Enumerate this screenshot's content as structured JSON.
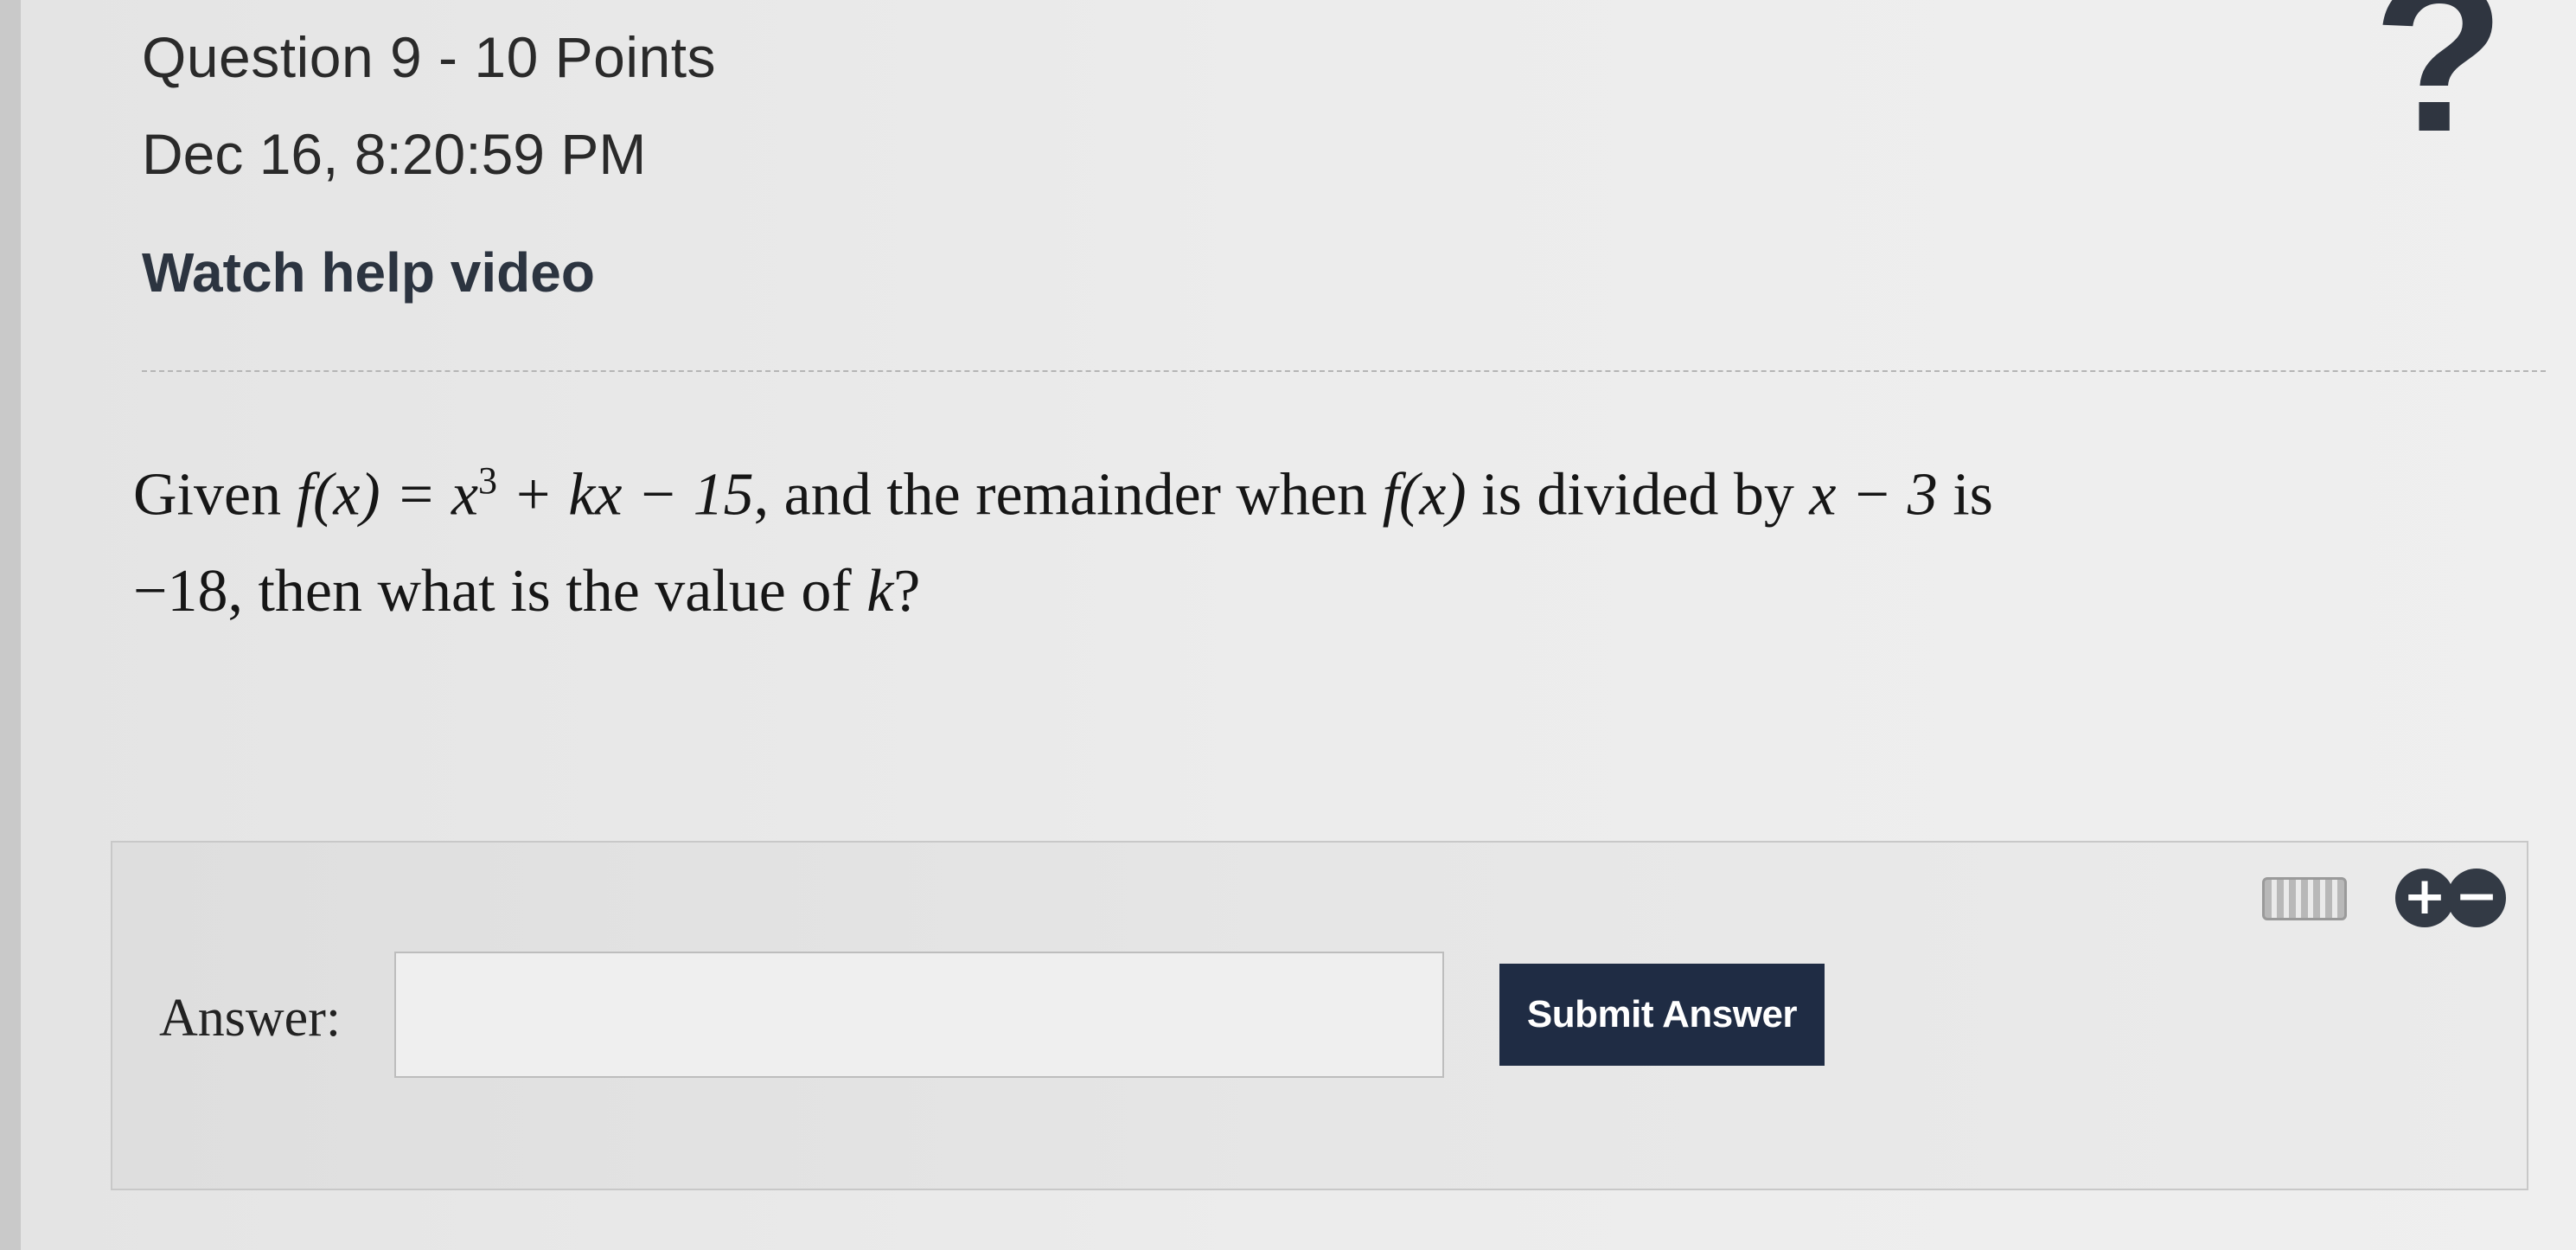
{
  "header": {
    "title": "Question 9 - 10 Points",
    "date": "Dec 16, 8:20:59 PM",
    "help_link": "Watch help video",
    "help_icon": "?"
  },
  "question": {
    "part1": "Given ",
    "expr1": "f(x) = x",
    "exp": "3",
    "expr2": " + kx − 15",
    "part2": ", and the remainder when ",
    "expr3": "f(x)",
    "part3": " is divided by ",
    "expr4": "x − 3",
    "part4": " is ",
    "expr5": "−18",
    "part5": ", then what is the value of ",
    "expr6": "k",
    "part6": "?"
  },
  "answer": {
    "label": "Answer:",
    "input_value": "",
    "submit_label": "Submit Answer",
    "plus": "+",
    "minus": "−"
  },
  "colors": {
    "button": "#1f2c44",
    "icons": "#333a45"
  }
}
